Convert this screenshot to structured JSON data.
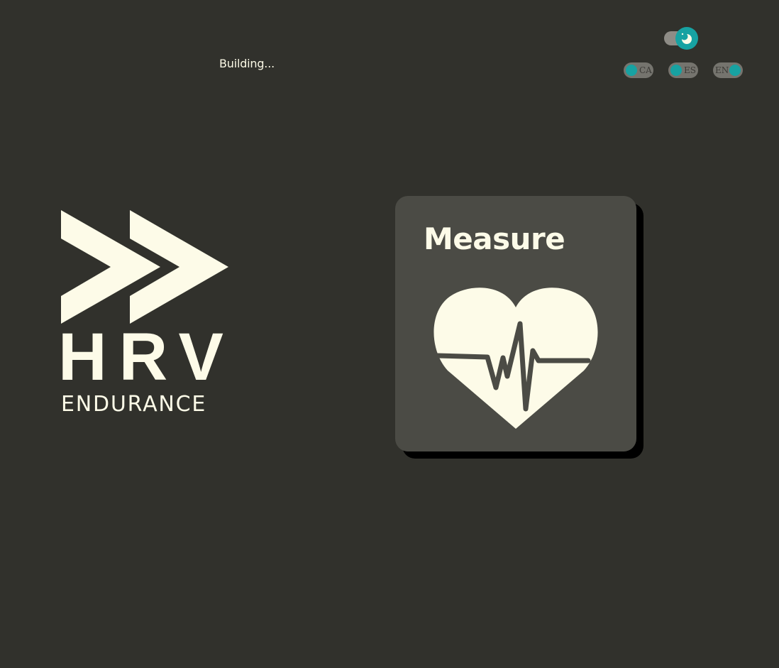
{
  "status": {
    "text": "Building..."
  },
  "theme_toggle": {
    "icon": "moon-icon",
    "state": "dark"
  },
  "languages": [
    {
      "code": "CA",
      "active": false
    },
    {
      "code": "ES",
      "active": false
    },
    {
      "code": "EN",
      "active": true
    }
  ],
  "logo": {
    "wordmark": "HRV",
    "tagline": "ENDURANCE"
  },
  "measure_card": {
    "title": "Measure",
    "icon": "heart-pulse-icon"
  },
  "colors": {
    "background": "#31312c",
    "card": "#4b4b45",
    "cream": "#fdfbe8",
    "accent": "#17a2a2"
  }
}
